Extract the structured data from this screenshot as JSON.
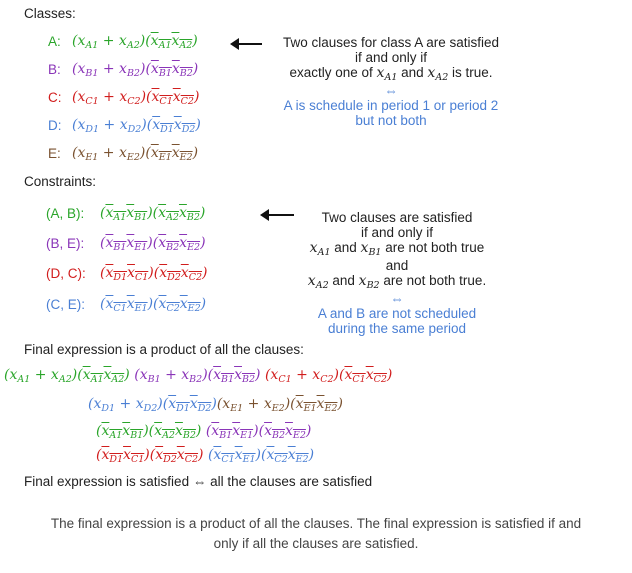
{
  "heading_classes": "Classes:",
  "classes": [
    {
      "label": "A:",
      "color": "#2aa52a",
      "l": "A"
    },
    {
      "label": "B:",
      "color": "#8a35b8",
      "l": "B"
    },
    {
      "label": "C:",
      "color": "#d11d1d",
      "l": "C"
    },
    {
      "label": "D:",
      "color": "#4a7fd4",
      "l": "D"
    },
    {
      "label": "E:",
      "color": "#7a5230",
      "l": "E"
    }
  ],
  "note_classes": {
    "line1": "Two clauses for class A are satisfied",
    "line2": "if and only if",
    "line3_pre": "exactly one of",
    "line3_mid": "and",
    "line3_post": "is true.",
    "equiv": "⇔",
    "line4": "A is schedule in period 1 or period 2",
    "line5": "but not both"
  },
  "heading_constraints": "Constraints:",
  "constraints": [
    {
      "label": "(A, B):",
      "color": "#2aa52a",
      "p": "A",
      "q": "B"
    },
    {
      "label": "(B, E):",
      "color": "#8a35b8",
      "p": "B",
      "q": "E"
    },
    {
      "label": "(D, C):",
      "color": "#d11d1d",
      "p": "D",
      "q": "C"
    },
    {
      "label": "(C, E):",
      "color": "#4a7fd4",
      "p": "C",
      "q": "E"
    }
  ],
  "note_constraints": {
    "line1": "Two clauses are satisfied",
    "line2": "if and only if",
    "line3": "and",
    "line3_post": "are not both true",
    "line4": "and",
    "line5_mid": "and",
    "line5_post": "are not both true.",
    "equiv": "⇔",
    "line6": "A and B are not scheduled",
    "line7": "during the same period"
  },
  "final_heading": "Final expression is a product of all the clauses:",
  "final_satisfied": "Final expression is satisfied ⇔ all the clauses are satisfied",
  "caption_line1": "The final expression is a product of all the clauses. The final expression is satisfied if and",
  "caption_line2": "only if all the clauses are satisfied.",
  "icons": [
    "left-arrow-icon"
  ]
}
